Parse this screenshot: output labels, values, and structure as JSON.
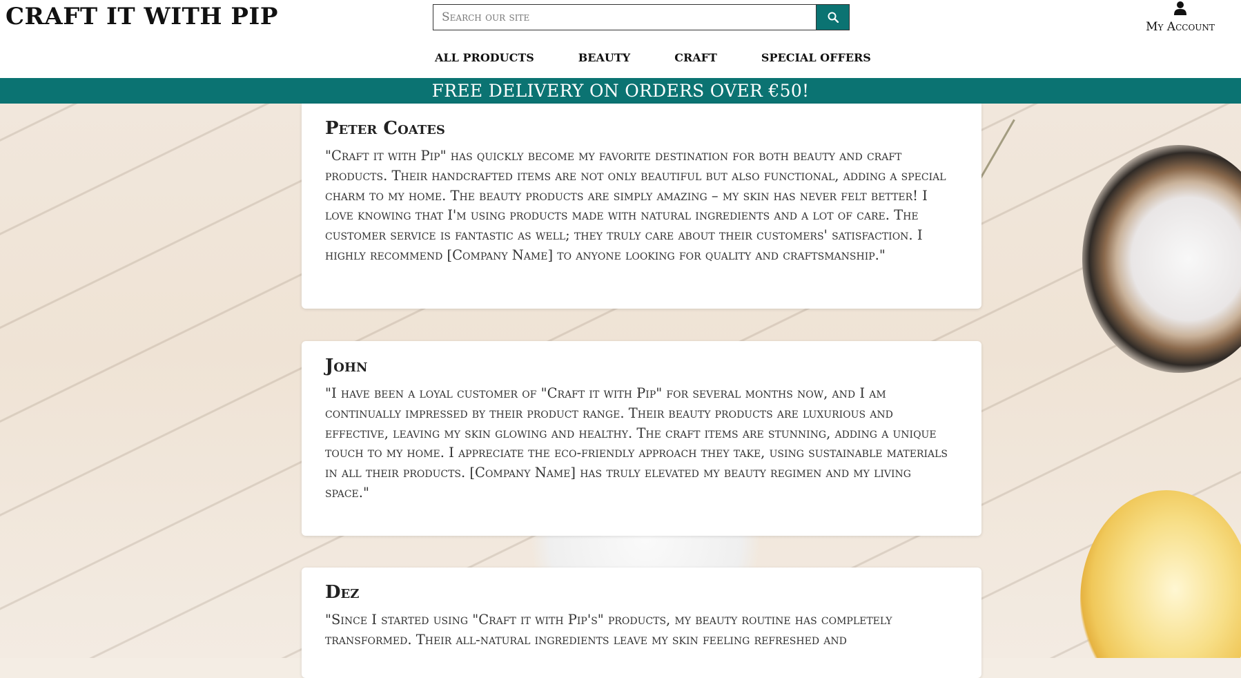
{
  "header": {
    "brand": "CRAFT IT WITH PIP",
    "search": {
      "placeholder": "Search our site",
      "value": ""
    },
    "search_button_icon": "search-icon",
    "account_icon": "user-icon",
    "account_label": "My Account"
  },
  "nav": {
    "items": [
      {
        "label": "ALL PRODUCTS"
      },
      {
        "label": "BEAUTY"
      },
      {
        "label": "CRAFT"
      },
      {
        "label": "SPECIAL OFFERS"
      }
    ]
  },
  "banner": {
    "text": "FREE DELIVERY ON ORDERS OVER €50!"
  },
  "colors": {
    "accent": "#0b7372",
    "card": "#ffffff",
    "text": "#333333"
  },
  "testimonials": [
    {
      "name": "Peter Coates",
      "text": "\"Craft it with Pip\" has quickly become my favorite destination for both beauty and craft products. Their handcrafted items are not only beautiful but also functional, adding a special charm to my home. The beauty products are simply amazing – my skin has never felt better! I love knowing that I'm using products made with natural ingredients and a lot of care. The customer service is fantastic as well; they truly care about their customers' satisfaction. I highly recommend [Company Name] to anyone looking for quality and craftsmanship.\""
    },
    {
      "name": "John",
      "text": "\"I have been a loyal customer of \"Craft it with Pip\" for several months now, and I am continually impressed by their product range. Their beauty products are luxurious and effective, leaving my skin glowing and healthy. The craft items are stunning, adding a unique touch to my home. I appreciate the eco-friendly approach they take, using sustainable materials in all their products. [Company Name] has truly elevated my beauty regimen and my living space.\""
    },
    {
      "name": "Dez",
      "text": "\"Since I started using \"Craft it with Pip's\" products, my beauty routine has completely transformed. Their all-natural ingredients leave my skin feeling refreshed and"
    }
  ]
}
